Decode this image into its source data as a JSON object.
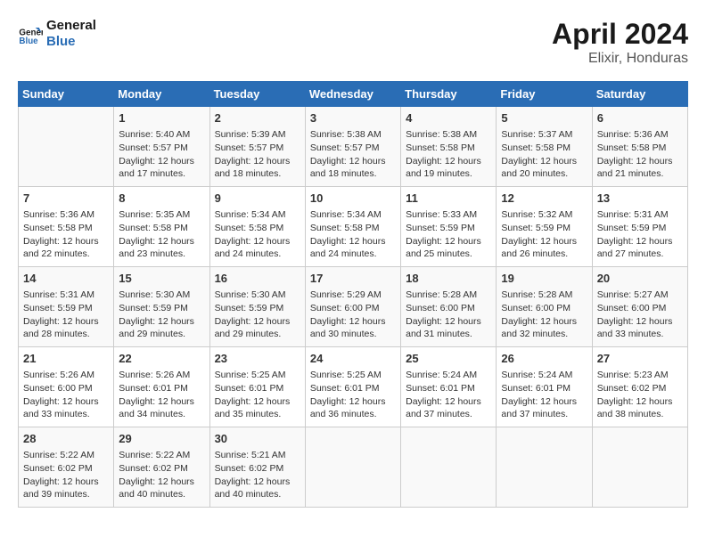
{
  "header": {
    "logo_line1": "General",
    "logo_line2": "Blue",
    "month": "April 2024",
    "location": "Elixir, Honduras"
  },
  "weekdays": [
    "Sunday",
    "Monday",
    "Tuesday",
    "Wednesday",
    "Thursday",
    "Friday",
    "Saturday"
  ],
  "weeks": [
    [
      {
        "day": "",
        "info": ""
      },
      {
        "day": "1",
        "info": "Sunrise: 5:40 AM\nSunset: 5:57 PM\nDaylight: 12 hours\nand 17 minutes."
      },
      {
        "day": "2",
        "info": "Sunrise: 5:39 AM\nSunset: 5:57 PM\nDaylight: 12 hours\nand 18 minutes."
      },
      {
        "day": "3",
        "info": "Sunrise: 5:38 AM\nSunset: 5:57 PM\nDaylight: 12 hours\nand 18 minutes."
      },
      {
        "day": "4",
        "info": "Sunrise: 5:38 AM\nSunset: 5:58 PM\nDaylight: 12 hours\nand 19 minutes."
      },
      {
        "day": "5",
        "info": "Sunrise: 5:37 AM\nSunset: 5:58 PM\nDaylight: 12 hours\nand 20 minutes."
      },
      {
        "day": "6",
        "info": "Sunrise: 5:36 AM\nSunset: 5:58 PM\nDaylight: 12 hours\nand 21 minutes."
      }
    ],
    [
      {
        "day": "7",
        "info": "Sunrise: 5:36 AM\nSunset: 5:58 PM\nDaylight: 12 hours\nand 22 minutes."
      },
      {
        "day": "8",
        "info": "Sunrise: 5:35 AM\nSunset: 5:58 PM\nDaylight: 12 hours\nand 23 minutes."
      },
      {
        "day": "9",
        "info": "Sunrise: 5:34 AM\nSunset: 5:58 PM\nDaylight: 12 hours\nand 24 minutes."
      },
      {
        "day": "10",
        "info": "Sunrise: 5:34 AM\nSunset: 5:58 PM\nDaylight: 12 hours\nand 24 minutes."
      },
      {
        "day": "11",
        "info": "Sunrise: 5:33 AM\nSunset: 5:59 PM\nDaylight: 12 hours\nand 25 minutes."
      },
      {
        "day": "12",
        "info": "Sunrise: 5:32 AM\nSunset: 5:59 PM\nDaylight: 12 hours\nand 26 minutes."
      },
      {
        "day": "13",
        "info": "Sunrise: 5:31 AM\nSunset: 5:59 PM\nDaylight: 12 hours\nand 27 minutes."
      }
    ],
    [
      {
        "day": "14",
        "info": "Sunrise: 5:31 AM\nSunset: 5:59 PM\nDaylight: 12 hours\nand 28 minutes."
      },
      {
        "day": "15",
        "info": "Sunrise: 5:30 AM\nSunset: 5:59 PM\nDaylight: 12 hours\nand 29 minutes."
      },
      {
        "day": "16",
        "info": "Sunrise: 5:30 AM\nSunset: 5:59 PM\nDaylight: 12 hours\nand 29 minutes."
      },
      {
        "day": "17",
        "info": "Sunrise: 5:29 AM\nSunset: 6:00 PM\nDaylight: 12 hours\nand 30 minutes."
      },
      {
        "day": "18",
        "info": "Sunrise: 5:28 AM\nSunset: 6:00 PM\nDaylight: 12 hours\nand 31 minutes."
      },
      {
        "day": "19",
        "info": "Sunrise: 5:28 AM\nSunset: 6:00 PM\nDaylight: 12 hours\nand 32 minutes."
      },
      {
        "day": "20",
        "info": "Sunrise: 5:27 AM\nSunset: 6:00 PM\nDaylight: 12 hours\nand 33 minutes."
      }
    ],
    [
      {
        "day": "21",
        "info": "Sunrise: 5:26 AM\nSunset: 6:00 PM\nDaylight: 12 hours\nand 33 minutes."
      },
      {
        "day": "22",
        "info": "Sunrise: 5:26 AM\nSunset: 6:01 PM\nDaylight: 12 hours\nand 34 minutes."
      },
      {
        "day": "23",
        "info": "Sunrise: 5:25 AM\nSunset: 6:01 PM\nDaylight: 12 hours\nand 35 minutes."
      },
      {
        "day": "24",
        "info": "Sunrise: 5:25 AM\nSunset: 6:01 PM\nDaylight: 12 hours\nand 36 minutes."
      },
      {
        "day": "25",
        "info": "Sunrise: 5:24 AM\nSunset: 6:01 PM\nDaylight: 12 hours\nand 37 minutes."
      },
      {
        "day": "26",
        "info": "Sunrise: 5:24 AM\nSunset: 6:01 PM\nDaylight: 12 hours\nand 37 minutes."
      },
      {
        "day": "27",
        "info": "Sunrise: 5:23 AM\nSunset: 6:02 PM\nDaylight: 12 hours\nand 38 minutes."
      }
    ],
    [
      {
        "day": "28",
        "info": "Sunrise: 5:22 AM\nSunset: 6:02 PM\nDaylight: 12 hours\nand 39 minutes."
      },
      {
        "day": "29",
        "info": "Sunrise: 5:22 AM\nSunset: 6:02 PM\nDaylight: 12 hours\nand 40 minutes."
      },
      {
        "day": "30",
        "info": "Sunrise: 5:21 AM\nSunset: 6:02 PM\nDaylight: 12 hours\nand 40 minutes."
      },
      {
        "day": "",
        "info": ""
      },
      {
        "day": "",
        "info": ""
      },
      {
        "day": "",
        "info": ""
      },
      {
        "day": "",
        "info": ""
      }
    ]
  ]
}
